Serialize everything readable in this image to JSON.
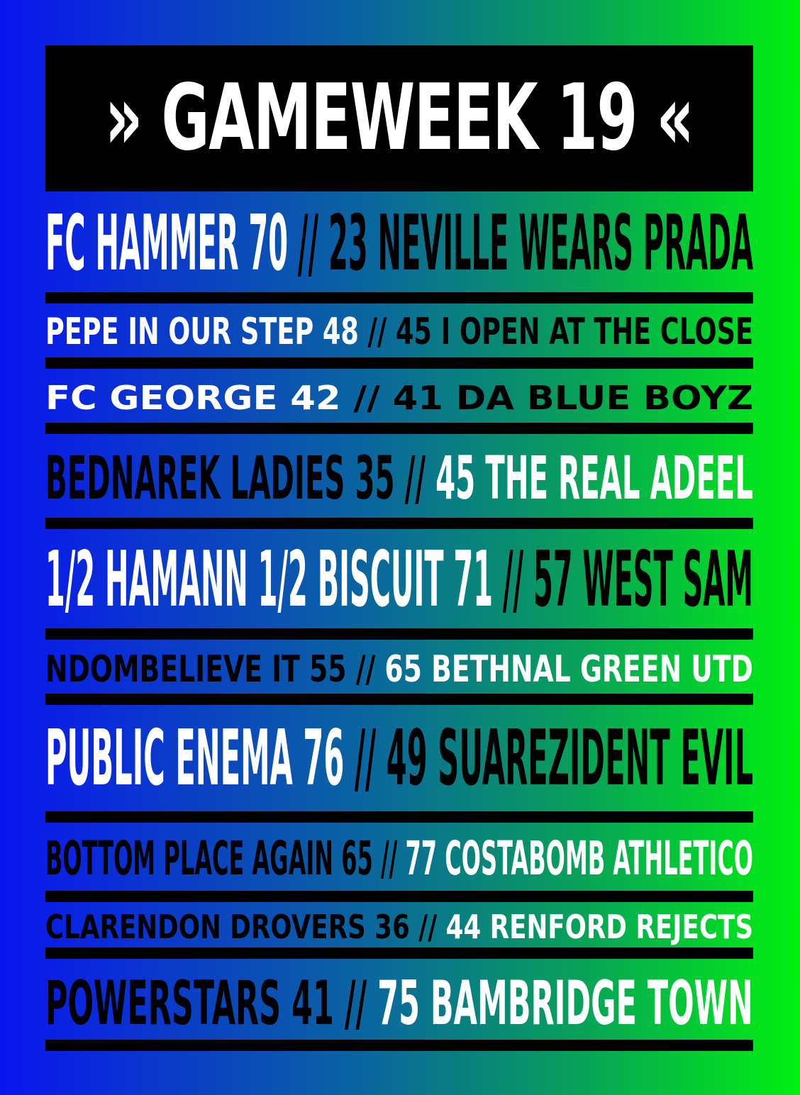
{
  "title": "GAMEWEEK 19",
  "colors": {
    "background_start": "#0a14f0",
    "background_end": "#00f010",
    "white": "#ffffff",
    "black": "#000000"
  },
  "fixtures": [
    {
      "left": "FC HAMMER 70",
      "sep": "//",
      "right": "23 NEVILLE WEARS PRADA"
    },
    {
      "left": "PEPE IN OUR STEP 48",
      "sep": "//",
      "right": "45 I OPEN AT THE CLOSE"
    },
    {
      "left": "FC GEORGE 42",
      "sep": "//",
      "right": "41 DA BLUE BOYZ"
    },
    {
      "left": "BEDNAREK LADIES 35",
      "sep": "//",
      "right": "45 THE REAL ADEEL"
    },
    {
      "left": "1/2 HAMANN 1/2 BISCUIT 71",
      "sep": "//",
      "right": "57 WEST SAM"
    },
    {
      "left": "NDOMBELIEVE IT 55",
      "sep": "//",
      "right": "65 BETHNAL GREEN UTD"
    },
    {
      "left": "PUBLIC ENEMA 76",
      "sep": "//",
      "right": "49 SUAREZIDENT EVIL"
    },
    {
      "left": "BOTTOM PLACE AGAIN 65",
      "sep": "//",
      "right": "77 COSTABOMB ATHLETICO"
    },
    {
      "left": "CLARENDON DROVERS 36",
      "sep": "//",
      "right": "44 RENFORD REJECTS"
    },
    {
      "left": "POWERSTARS 41",
      "sep": "//",
      "right": "75 BAMBRIDGE TOWN"
    }
  ]
}
